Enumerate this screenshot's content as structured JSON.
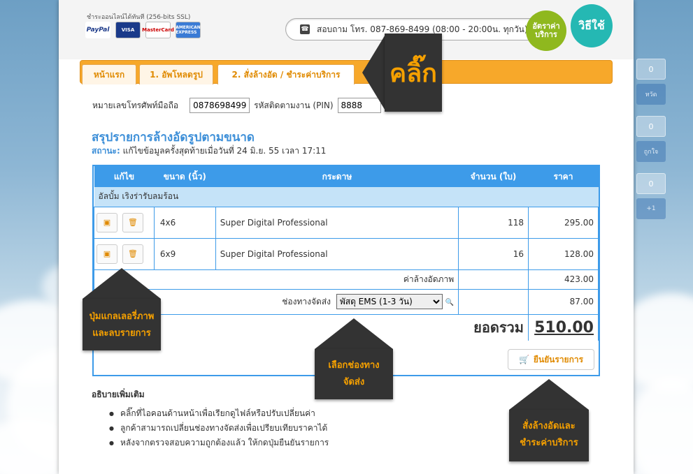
{
  "header": {
    "payment_label": "ชำระออนไลน์ได้ทันที (256-bits SSL)",
    "cards": [
      "PayPal",
      "VISA",
      "MasterCard",
      "AMERICAN EXPRESS"
    ],
    "phone_text": "สอบถาม โทร. 087-869-8499 (08:00 - 20:00น. ทุกวัน)",
    "tag_rates": "อัตราค่าบริการ",
    "tag_howto": "วิธีใช้"
  },
  "tabs": [
    {
      "label": "หน้าแรก"
    },
    {
      "label": "1. อัพโหลดรูป"
    },
    {
      "label": "2. สั่งล้างอัด / ชำระค่าบริการ"
    }
  ],
  "form": {
    "phone_label": "หมายเลขโทรศัพท์มือถือ",
    "phone_value": "0878698499",
    "pin_label": "รหัสติดตามงาน (PIN)",
    "pin_value": "8888"
  },
  "summary": {
    "title": "สรุปรายการล้างอัดรูปตามขนาด",
    "status_label": "สถานะ:",
    "status_text": "แก้ไขข้อมูลครั้งสุดท้ายเมื่อวันที่ 24 มิ.ย. 55 เวลา 17:11"
  },
  "table": {
    "headers": [
      "แก้ไข",
      "ขนาด (นิ้ว)",
      "กระดาษ",
      "จำนวน (ใบ)",
      "ราคา"
    ],
    "group": "อัลบั้ม เริงร่ารับลมร้อน",
    "rows": [
      {
        "size": "4x6",
        "paper": "Super Digital Professional",
        "qty": "118",
        "price": "295.00"
      },
      {
        "size": "6x9",
        "paper": "Super Digital Professional",
        "qty": "16",
        "price": "128.00"
      }
    ],
    "subtotal_label": "ค่าล้างอัดภาพ",
    "subtotal_value": "423.00",
    "shipping_label": "ช่องทางจัดส่ง",
    "shipping_option": "พัสดุ EMS (1-3 วัน)",
    "shipping_value": "87.00",
    "total_label": "ยอดรวม",
    "total_value": "510.00",
    "confirm_label": "ยืนยันรายการ"
  },
  "notes": {
    "title": "อธิบายเพิ่มเติม",
    "items": [
      "คลิ๊กที่ไอคอนด้านหน้าเพื่อเรียกดูไฟล์หรือปรับเปลี่ยนค่า",
      "ลูกค้าสามารถเปลี่ยนช่องทางจัดส่งเพื่อเปรียบเทียบราคาได้",
      "หลังจากตรวจสอบความถูกต้องแล้ว ให้กดปุ่มยืนยันรายการ"
    ]
  },
  "callouts": {
    "click": "คลิ๊ก",
    "gallery_1": "ปุ่มแกลเลอรี่ภาพ",
    "gallery_2": "และลบรายการ",
    "ship_1": "เลือกช่องทาง",
    "ship_2": "จัดส่ง",
    "confirm_1": "สั่งล้างอัดและ",
    "confirm_2": "ชำระค่าบริการ"
  },
  "social": [
    {
      "count": "0",
      "label": "หวัด"
    },
    {
      "count": "0",
      "label": "ถูกใจ"
    },
    {
      "count": "0",
      "label": "+1"
    }
  ]
}
